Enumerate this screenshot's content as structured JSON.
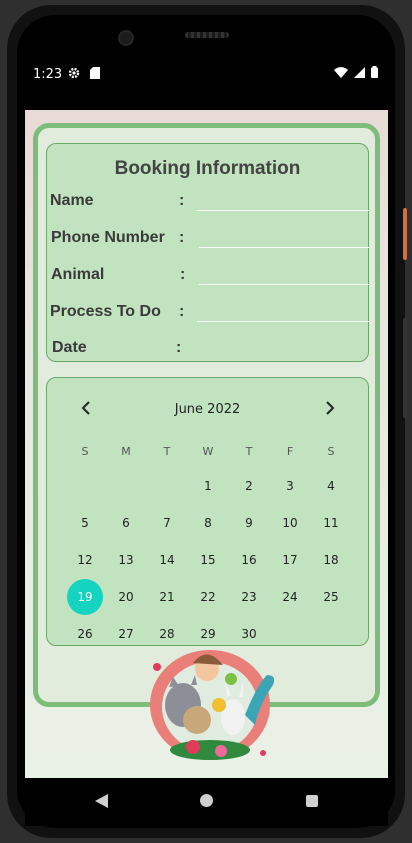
{
  "status": {
    "time": "1:23"
  },
  "booking": {
    "title": "Booking Information",
    "rows": [
      {
        "label": "Name",
        "colon": ":",
        "value": ""
      },
      {
        "label": "Phone Number",
        "colon": ":",
        "value": ""
      },
      {
        "label": "Animal",
        "colon": ":",
        "value": ""
      },
      {
        "label": "Process To Do",
        "colon": ":",
        "value": ""
      },
      {
        "label": "Date",
        "colon": ":",
        "value": ""
      }
    ]
  },
  "calendar": {
    "month_label": "June 2022",
    "weekdays": [
      "S",
      "M",
      "T",
      "W",
      "T",
      "F",
      "S"
    ],
    "selected_day": "19",
    "days": [
      "1",
      "2",
      "3",
      "4",
      "5",
      "6",
      "7",
      "8",
      "9",
      "10",
      "11",
      "12",
      "13",
      "14",
      "15",
      "16",
      "17",
      "18",
      "19",
      "20",
      "21",
      "22",
      "23",
      "24",
      "25",
      "26",
      "27",
      "28",
      "29",
      "30"
    ],
    "first_weekday_index": 3
  },
  "colors": {
    "accent": "#14d3c0",
    "card_bg": "#c2e3c0",
    "card_border": "#7cbd7a"
  }
}
